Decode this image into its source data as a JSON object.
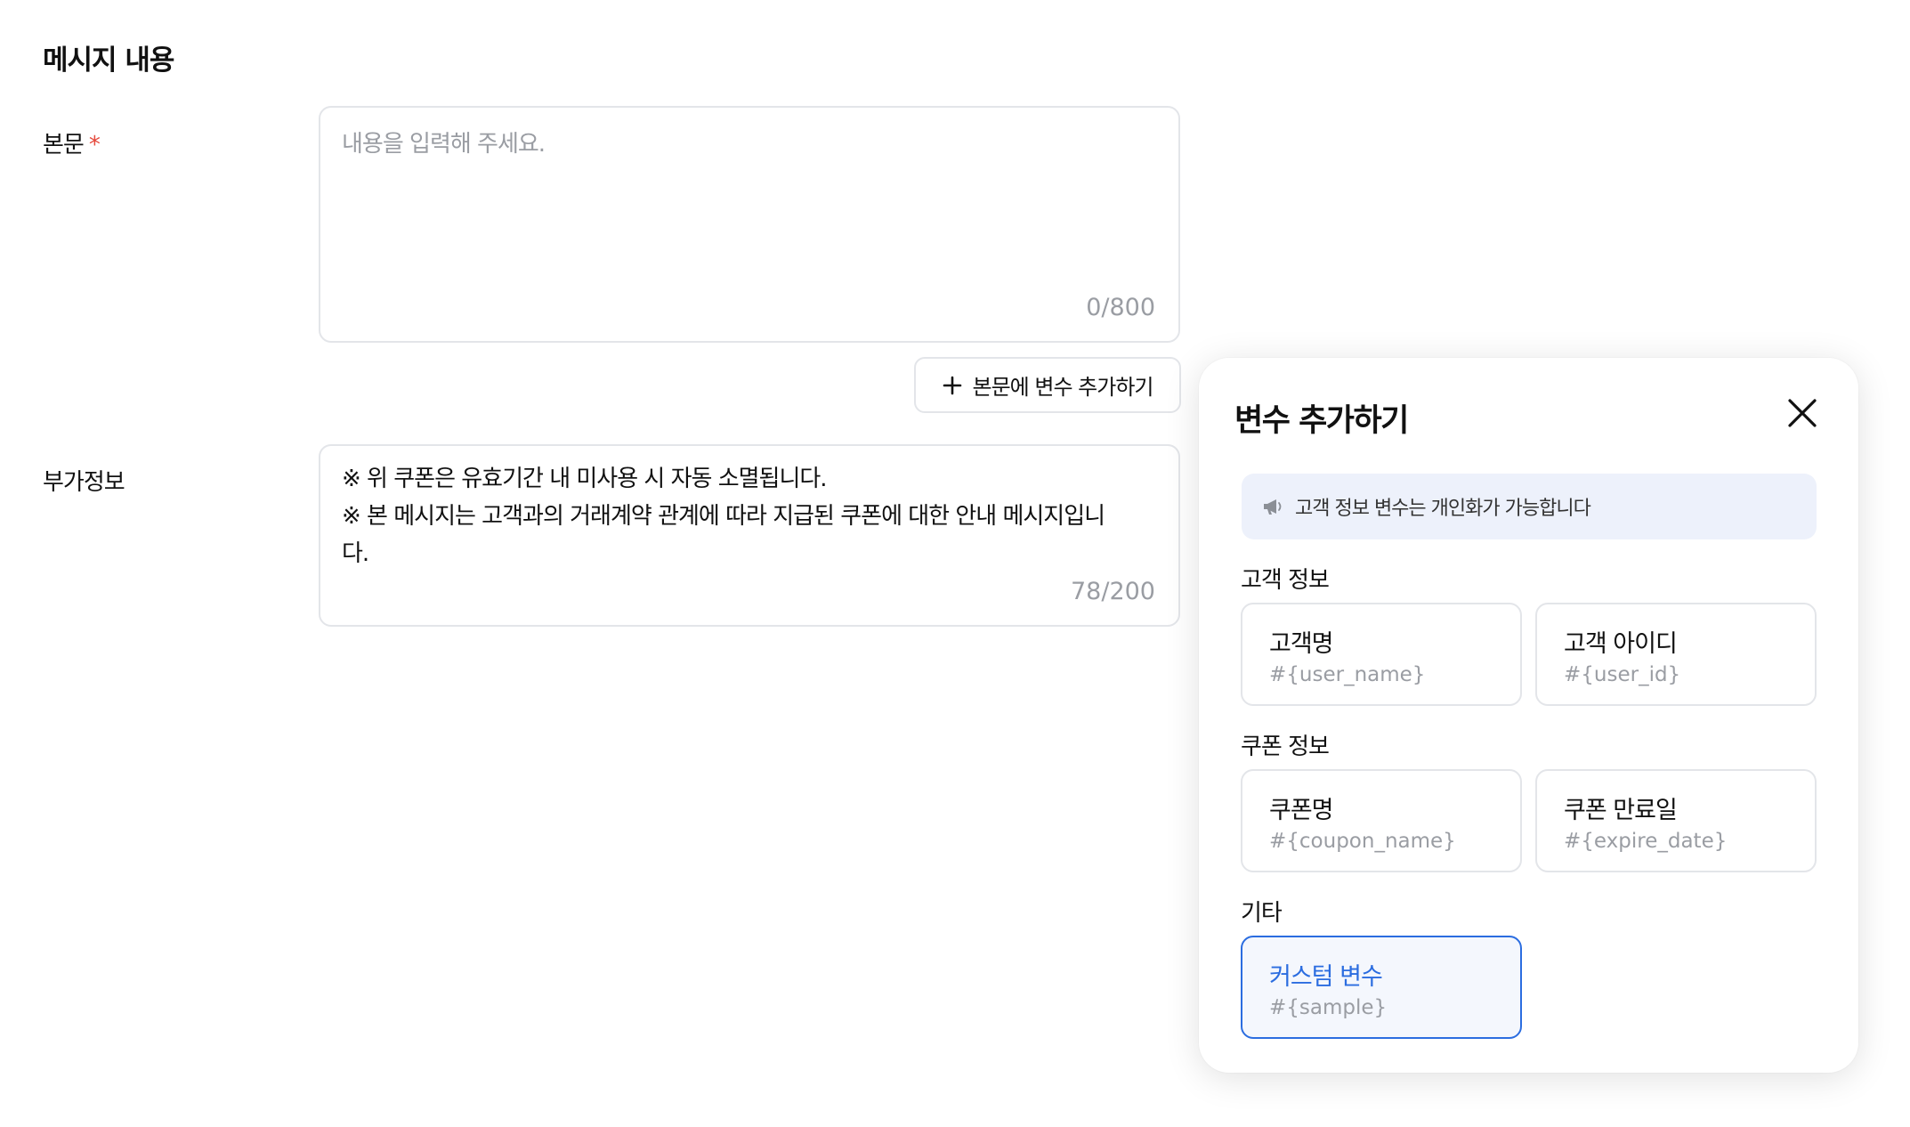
{
  "section": {
    "title": "메시지 내용"
  },
  "body_field": {
    "label": "본문",
    "required_mark": "*",
    "placeholder": "내용을 입력해 주세요.",
    "counter": "0/800"
  },
  "add_variable_button": {
    "label": "본문에 변수 추가하기",
    "icon": "plus-icon"
  },
  "extra_field": {
    "label": "부가정보",
    "lines": [
      "※ 위 쿠폰은 유효기간 내 미사용 시 자동 소멸됩니다.",
      "※ 본 메시지는 고객과의 거래계약 관계에 따라 지급된 쿠폰에 대한 안내 메시지입니",
      "다."
    ],
    "counter": "78/200"
  },
  "panel": {
    "title": "변수 추가하기",
    "close_icon": "close-icon",
    "notice": {
      "icon": "megaphone-icon",
      "text": "고객 정보 변수는 개인화가 가능합니다"
    },
    "groups": [
      {
        "title": "고객 정보",
        "items": [
          {
            "name": "고객명",
            "code": "#{user_name}"
          },
          {
            "name": "고객 아이디",
            "code": "#{user_id}"
          }
        ]
      },
      {
        "title": "쿠폰 정보",
        "items": [
          {
            "name": "쿠폰명",
            "code": "#{coupon_name}"
          },
          {
            "name": "쿠폰 만료일",
            "code": "#{expire_date}"
          }
        ]
      },
      {
        "title": "기타",
        "items": [
          {
            "name": "커스텀 변수",
            "code": "#{sample}",
            "selected": true
          }
        ]
      }
    ]
  },
  "colors": {
    "accent": "#2b6de0",
    "required": "#e5483b",
    "notice_bg": "#edf1fb",
    "border": "#e3e5e9",
    "muted_text": "#9a9da3"
  }
}
